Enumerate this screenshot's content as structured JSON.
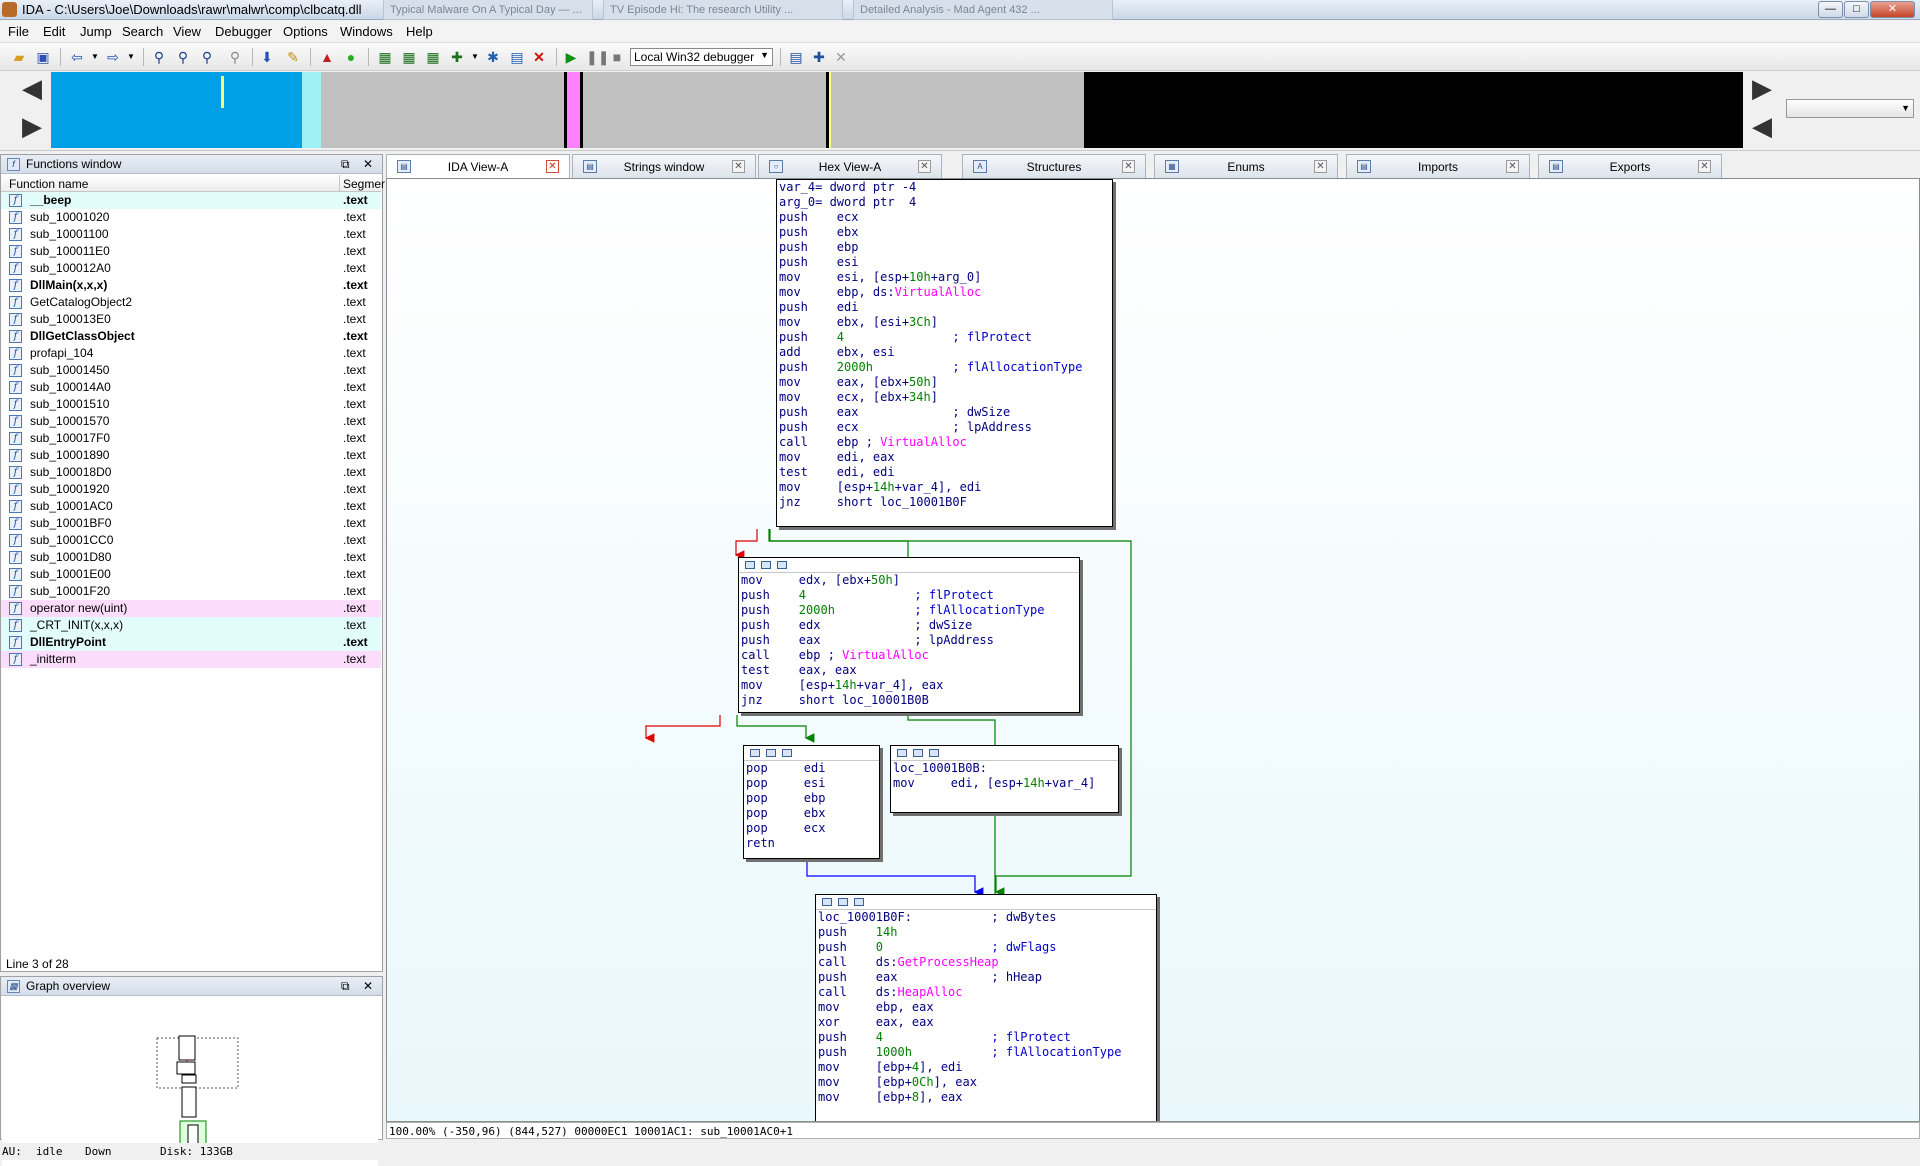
{
  "window": {
    "title": "IDA - C:\\Users\\Joe\\Downloads\\rawr\\malwr\\comp\\clbcatq.dll",
    "controls": {
      "minimize": "—",
      "maximize": "□",
      "close": "✕"
    },
    "background_tabs": [
      "Typical Malware On A Typical Day — ...",
      "TV Episode Hi: The research Utility ...",
      "Detailed Analysis - Mad Agent 432 ..."
    ]
  },
  "menu": [
    "File",
    "Edit",
    "Jump",
    "Search",
    "View",
    "Debugger",
    "Options",
    "Windows",
    "Help"
  ],
  "toolbar": {
    "debugger_selected": "Local Win32 debugger",
    "icons": [
      "open-icon",
      "save-icon",
      "back-icon",
      "forward-icon",
      "binary-search-icon",
      "text-search-icon",
      "search-next-icon",
      "search-prev-icon",
      "jump-icon",
      "mark-icon",
      "graph-icon",
      "green-dot-icon",
      "struct-icon",
      "enum-icon",
      "add-icon",
      "script-icon",
      "patch-icon",
      "close-red-icon",
      "run-icon",
      "pause-icon",
      "stop-icon",
      "breakpoint-icon",
      "trace-icon",
      "detach-icon"
    ]
  },
  "colors": {
    "nav_code": "#00a0e6",
    "nav_lib": "#a0f0f8",
    "nav_data": "#c0c0c0",
    "nav_import": "#ff80ff",
    "nav_unexplored": "#000000",
    "edge_true": "#008000",
    "edge_false": "#e00000",
    "edge_uncond": "#0000ff"
  },
  "functions_window": {
    "title": "Functions window",
    "col_name": "Function name",
    "col_segment": "Segmer",
    "rows": [
      {
        "name": "__beep",
        "seg": ".text",
        "bold": true,
        "kind": "lib"
      },
      {
        "name": "sub_10001020",
        "seg": ".text",
        "bold": false,
        "kind": "normal"
      },
      {
        "name": "sub_10001100",
        "seg": ".text",
        "bold": false,
        "kind": "normal"
      },
      {
        "name": "sub_100011E0",
        "seg": ".text",
        "bold": false,
        "kind": "normal"
      },
      {
        "name": "sub_100012A0",
        "seg": ".text",
        "bold": false,
        "kind": "normal"
      },
      {
        "name": "DllMain(x,x,x)",
        "seg": ".text",
        "bold": true,
        "kind": "normal"
      },
      {
        "name": "GetCatalogObject2",
        "seg": ".text",
        "bold": false,
        "kind": "normal"
      },
      {
        "name": "sub_100013E0",
        "seg": ".text",
        "bold": false,
        "kind": "normal"
      },
      {
        "name": "DllGetClassObject",
        "seg": ".text",
        "bold": true,
        "kind": "normal"
      },
      {
        "name": "profapi_104",
        "seg": ".text",
        "bold": false,
        "kind": "normal"
      },
      {
        "name": "sub_10001450",
        "seg": ".text",
        "bold": false,
        "kind": "normal"
      },
      {
        "name": "sub_100014A0",
        "seg": ".text",
        "bold": false,
        "kind": "normal"
      },
      {
        "name": "sub_10001510",
        "seg": ".text",
        "bold": false,
        "kind": "normal"
      },
      {
        "name": "sub_10001570",
        "seg": ".text",
        "bold": false,
        "kind": "normal"
      },
      {
        "name": "sub_100017F0",
        "seg": ".text",
        "bold": false,
        "kind": "normal"
      },
      {
        "name": "sub_10001890",
        "seg": ".text",
        "bold": false,
        "kind": "normal"
      },
      {
        "name": "sub_100018D0",
        "seg": ".text",
        "bold": false,
        "kind": "normal"
      },
      {
        "name": "sub_10001920",
        "seg": ".text",
        "bold": false,
        "kind": "normal"
      },
      {
        "name": "sub_10001AC0",
        "seg": ".text",
        "bold": false,
        "kind": "normal"
      },
      {
        "name": "sub_10001BF0",
        "seg": ".text",
        "bold": false,
        "kind": "normal"
      },
      {
        "name": "sub_10001CC0",
        "seg": ".text",
        "bold": false,
        "kind": "normal"
      },
      {
        "name": "sub_10001D80",
        "seg": ".text",
        "bold": false,
        "kind": "normal"
      },
      {
        "name": "sub_10001E00",
        "seg": ".text",
        "bold": false,
        "kind": "normal"
      },
      {
        "name": "sub_10001F20",
        "seg": ".text",
        "bold": false,
        "kind": "normal"
      },
      {
        "name": "operator new(uint)",
        "seg": ".text",
        "bold": false,
        "kind": "imp"
      },
      {
        "name": "_CRT_INIT(x,x,x)",
        "seg": ".text",
        "bold": false,
        "kind": "lib"
      },
      {
        "name": "DllEntryPoint",
        "seg": ".text",
        "bold": true,
        "kind": "lib"
      },
      {
        "name": "_initterm",
        "seg": ".text",
        "bold": false,
        "kind": "imp"
      }
    ],
    "line_status": "Line 3 of 28"
  },
  "graph_overview": {
    "title": "Graph overview"
  },
  "tabs": [
    {
      "label": "IDA View-A",
      "icon": "ida-view-icon",
      "active": true
    },
    {
      "label": "Strings window",
      "icon": "strings-icon",
      "active": false
    },
    {
      "label": "Hex View-A",
      "icon": "hex-view-icon",
      "active": false
    },
    {
      "label": "Structures",
      "icon": "structures-icon",
      "active": false
    },
    {
      "label": "Enums",
      "icon": "enums-icon",
      "active": false
    },
    {
      "label": "Imports",
      "icon": "imports-icon",
      "active": false
    },
    {
      "label": "Exports",
      "icon": "exports-icon",
      "active": false
    }
  ],
  "graph": {
    "nodes": [
      {
        "id": "entry",
        "header": false,
        "lines": [
          [
            [
              "var_4= dword ptr -4",
              "m"
            ]
          ],
          [
            [
              "arg_0= dword ptr  4",
              "m"
            ]
          ],
          [
            [
              "",
              ""
            ]
          ],
          [
            [
              "push    ecx",
              "m"
            ]
          ],
          [
            [
              "push    ebx",
              "m"
            ]
          ],
          [
            [
              "push    ebp",
              "m"
            ]
          ],
          [
            [
              "push    esi",
              "m"
            ]
          ],
          [
            [
              "mov     esi, [esp+",
              "m"
            ],
            [
              "10h",
              "n"
            ],
            [
              "+arg_0]",
              "m"
            ]
          ],
          [
            [
              "mov     ebp, ds:",
              "m"
            ],
            [
              "VirtualAlloc",
              "p"
            ]
          ],
          [
            [
              "push    edi",
              "m"
            ]
          ],
          [
            [
              "mov     ebx, [esi+",
              "m"
            ],
            [
              "3Ch",
              "n"
            ],
            [
              "]",
              "m"
            ]
          ],
          [
            [
              "push    ",
              "m"
            ],
            [
              "4",
              "n"
            ],
            [
              "               ; flProtect",
              "c"
            ]
          ],
          [
            [
              "add     ebx, esi",
              "m"
            ]
          ],
          [
            [
              "push    ",
              "m"
            ],
            [
              "2000h",
              "n"
            ],
            [
              "           ; flAllocationType",
              "c"
            ]
          ],
          [
            [
              "mov     eax, [ebx+",
              "m"
            ],
            [
              "50h",
              "n"
            ],
            [
              "]",
              "m"
            ]
          ],
          [
            [
              "mov     ecx, [ebx+",
              "m"
            ],
            [
              "34h",
              "n"
            ],
            [
              "]",
              "m"
            ]
          ],
          [
            [
              "push    eax             ; dwSize",
              "m"
            ]
          ],
          [
            [
              "push    ecx             ; lpAddress",
              "m"
            ]
          ],
          [
            [
              "call    ebp ; ",
              "m"
            ],
            [
              "VirtualAlloc",
              "p"
            ]
          ],
          [
            [
              "mov     edi, eax",
              "m"
            ]
          ],
          [
            [
              "test    edi, edi",
              "m"
            ]
          ],
          [
            [
              "mov     [esp+",
              "m"
            ],
            [
              "14h",
              "n"
            ],
            [
              "+var_4], edi",
              "m"
            ]
          ],
          [
            [
              "jnz     short loc_10001B0F",
              "m"
            ]
          ]
        ]
      },
      {
        "id": "retry",
        "header": true,
        "lines": [
          [
            [
              "mov     edx, [ebx+",
              "m"
            ],
            [
              "50h",
              "n"
            ],
            [
              "]",
              "m"
            ]
          ],
          [
            [
              "push    ",
              "m"
            ],
            [
              "4",
              "n"
            ],
            [
              "               ; flProtect",
              "c"
            ]
          ],
          [
            [
              "push    ",
              "m"
            ],
            [
              "2000h",
              "n"
            ],
            [
              "           ; flAllocationType",
              "c"
            ]
          ],
          [
            [
              "push    edx             ; dwSize",
              "m"
            ]
          ],
          [
            [
              "push    eax             ; lpAddress",
              "m"
            ]
          ],
          [
            [
              "call    ebp ; ",
              "m"
            ],
            [
              "VirtualAlloc",
              "p"
            ]
          ],
          [
            [
              "test    eax, eax",
              "m"
            ]
          ],
          [
            [
              "mov     [esp+",
              "m"
            ],
            [
              "14h",
              "n"
            ],
            [
              "+var_4], eax",
              "m"
            ]
          ],
          [
            [
              "jnz     short loc_10001B0B",
              "m"
            ]
          ]
        ]
      },
      {
        "id": "fail",
        "header": true,
        "lines": [
          [
            [
              "pop     edi",
              "m"
            ]
          ],
          [
            [
              "pop     esi",
              "m"
            ]
          ],
          [
            [
              "pop     ebp",
              "m"
            ]
          ],
          [
            [
              "pop     ebx",
              "m"
            ]
          ],
          [
            [
              "pop     ecx",
              "m"
            ]
          ],
          [
            [
              "retn",
              "m"
            ]
          ]
        ]
      },
      {
        "id": "b0b",
        "header": true,
        "lines": [
          [
            [
              "",
              ""
            ]
          ],
          [
            [
              "loc_10001B0B:",
              "m"
            ]
          ],
          [
            [
              "mov     edi, [esp+",
              "m"
            ],
            [
              "14h",
              "n"
            ],
            [
              "+var_4]",
              "m"
            ]
          ]
        ]
      },
      {
        "id": "b0f",
        "header": true,
        "lines": [
          [
            [
              "",
              ""
            ]
          ],
          [
            [
              "loc_10001B0F:           ; dwBytes",
              "m"
            ]
          ],
          [
            [
              "push    ",
              "m"
            ],
            [
              "14h",
              "n"
            ]
          ],
          [
            [
              "push    ",
              "m"
            ],
            [
              "0",
              "n"
            ],
            [
              "               ; dwFlags",
              "c"
            ]
          ],
          [
            [
              "call    ds:",
              "m"
            ],
            [
              "GetProcessHeap",
              "p"
            ]
          ],
          [
            [
              "push    eax             ; hHeap",
              "m"
            ]
          ],
          [
            [
              "call    ds:",
              "m"
            ],
            [
              "HeapAlloc",
              "p"
            ]
          ],
          [
            [
              "mov     ebp, eax",
              "m"
            ]
          ],
          [
            [
              "xor     eax, eax",
              "m"
            ]
          ],
          [
            [
              "push    ",
              "m"
            ],
            [
              "4",
              "n"
            ],
            [
              "               ; flProtect",
              "c"
            ]
          ],
          [
            [
              "push    ",
              "m"
            ],
            [
              "1000h",
              "n"
            ],
            [
              "           ; flAllocationType",
              "c"
            ]
          ],
          [
            [
              "mov     [ebp+",
              "m"
            ],
            [
              "4",
              "n"
            ],
            [
              "], edi",
              "m"
            ]
          ],
          [
            [
              "mov     [ebp+",
              "m"
            ],
            [
              "0Ch",
              "n"
            ],
            [
              "], eax",
              "m"
            ]
          ],
          [
            [
              "mov     [ebp+",
              "m"
            ],
            [
              "8",
              "n"
            ],
            [
              "], eax",
              "m"
            ]
          ]
        ]
      }
    ]
  },
  "graph_status": "100.00% (-350,96) (844,527) 00000EC1 10001AC1: sub_10001AC0+1",
  "statusbar": {
    "au_label": "AU:",
    "au_state": "idle",
    "direction": "Down",
    "disk": "Disk: 133GB"
  }
}
